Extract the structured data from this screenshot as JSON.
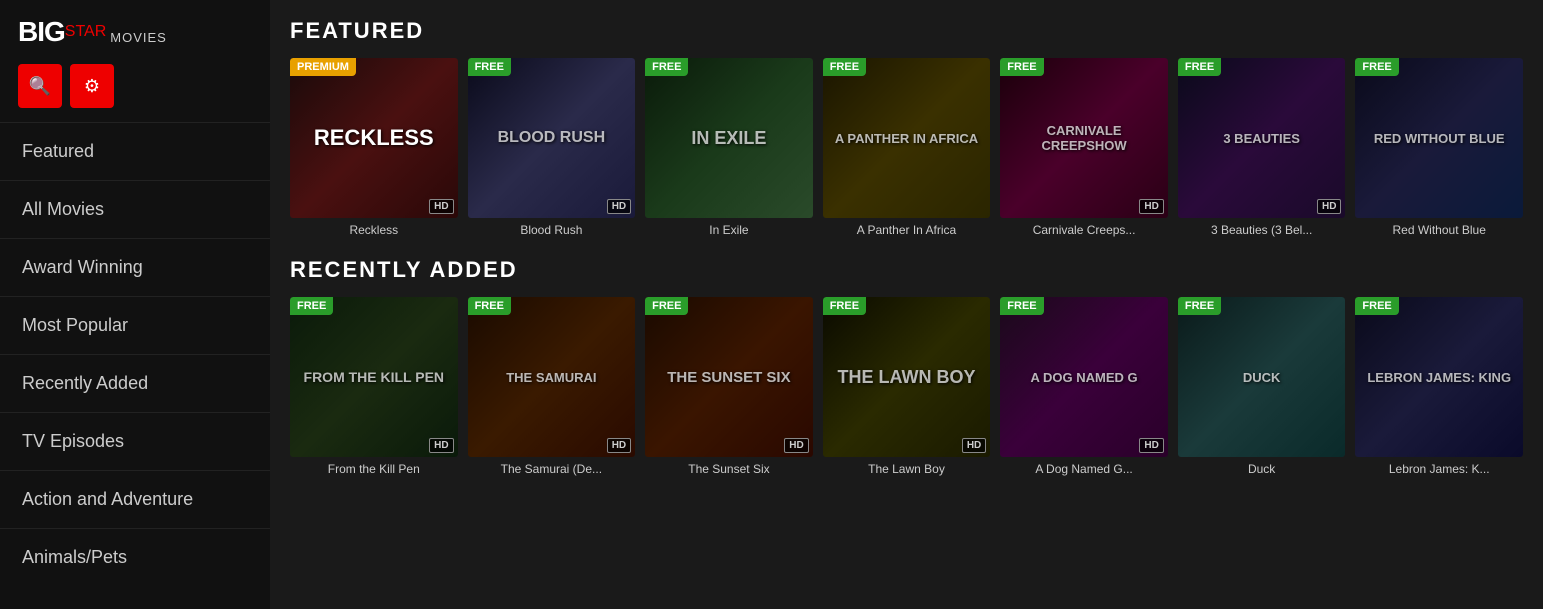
{
  "logo": {
    "big": "BIG",
    "star": "STAR",
    "movies": "MOVIES"
  },
  "sidebar": {
    "items": [
      {
        "label": "Featured",
        "id": "featured"
      },
      {
        "label": "All Movies",
        "id": "all-movies"
      },
      {
        "label": "Award Winning",
        "id": "award-winning"
      },
      {
        "label": "Most Popular",
        "id": "most-popular"
      },
      {
        "label": "Recently Added",
        "id": "recently-added"
      },
      {
        "label": "TV Episodes",
        "id": "tv-episodes"
      },
      {
        "label": "Action and Adventure",
        "id": "action-adventure"
      },
      {
        "label": "Animals/Pets",
        "id": "animals-pets"
      }
    ]
  },
  "sections": [
    {
      "id": "featured",
      "title": "FEATURED",
      "movies": [
        {
          "id": "reckless",
          "title": "Reckless",
          "badge": "PREMIUM",
          "badge_type": "premium",
          "hd": true,
          "poster_class": "poster-reckless",
          "poster_text": "RECKLESS"
        },
        {
          "id": "blood-rush",
          "title": "Blood Rush",
          "badge": "FREE",
          "badge_type": "free",
          "hd": true,
          "poster_class": "poster-blood-rush",
          "poster_text": "BLOOD RUSH"
        },
        {
          "id": "in-exile",
          "title": "In Exile",
          "badge": "FREE",
          "badge_type": "free",
          "hd": false,
          "poster_class": "poster-in-exile",
          "poster_text": "IN EXILE"
        },
        {
          "id": "panther",
          "title": "A Panther In Africa",
          "badge": "FREE",
          "badge_type": "free",
          "hd": false,
          "poster_class": "poster-panther",
          "poster_text": "A PANTHER IN AFRICA"
        },
        {
          "id": "carnivale",
          "title": "Carnivale Creeps...",
          "badge": "FREE",
          "badge_type": "free",
          "hd": true,
          "poster_class": "poster-carnivale",
          "poster_text": "CARNIVALE CREEPSHOW"
        },
        {
          "id": "beauties",
          "title": "3 Beauties (3 Bel...",
          "badge": "FREE",
          "badge_type": "free",
          "hd": true,
          "poster_class": "poster-beauties",
          "poster_text": "3 BEAUTIES"
        },
        {
          "id": "red-blue",
          "title": "Red Without Blue",
          "badge": "FREE",
          "badge_type": "free",
          "hd": false,
          "poster_class": "poster-red-blue",
          "poster_text": "RED WITHOUT BLUE"
        }
      ]
    },
    {
      "id": "recently-added",
      "title": "RECENTLY ADDED",
      "movies": [
        {
          "id": "kill-pen",
          "title": "From the Kill Pen",
          "badge": "FREE",
          "badge_type": "free",
          "hd": true,
          "poster_class": "poster-kill-pen",
          "poster_text": "FROM THE KILL PEN"
        },
        {
          "id": "samurai",
          "title": "The Samurai (De...",
          "badge": "FREE",
          "badge_type": "free",
          "hd": true,
          "poster_class": "poster-samurai",
          "poster_text": "THE SAMURAI"
        },
        {
          "id": "sunset",
          "title": "The Sunset Six",
          "badge": "FREE",
          "badge_type": "free",
          "hd": true,
          "poster_class": "poster-sunset",
          "poster_text": "THE SUNSET SIX"
        },
        {
          "id": "lawn-boy",
          "title": "The Lawn Boy",
          "badge": "FREE",
          "badge_type": "free",
          "hd": true,
          "poster_class": "poster-lawn-boy",
          "poster_text": "THE LAWN BOY"
        },
        {
          "id": "dog",
          "title": "A Dog Named G...",
          "badge": "FREE",
          "badge_type": "free",
          "hd": true,
          "poster_class": "poster-dog",
          "poster_text": "A DOG NAMED G"
        },
        {
          "id": "duck",
          "title": "Duck",
          "badge": "FREE",
          "badge_type": "free",
          "hd": false,
          "poster_class": "poster-duck",
          "poster_text": "DUCK"
        },
        {
          "id": "lebron",
          "title": "Lebron James: K...",
          "badge": "FREE",
          "badge_type": "free",
          "hd": false,
          "poster_class": "poster-lebron",
          "poster_text": "LEBRON JAMES: KING"
        }
      ]
    }
  ],
  "icons": {
    "search": "🔍",
    "settings": "⚙"
  }
}
